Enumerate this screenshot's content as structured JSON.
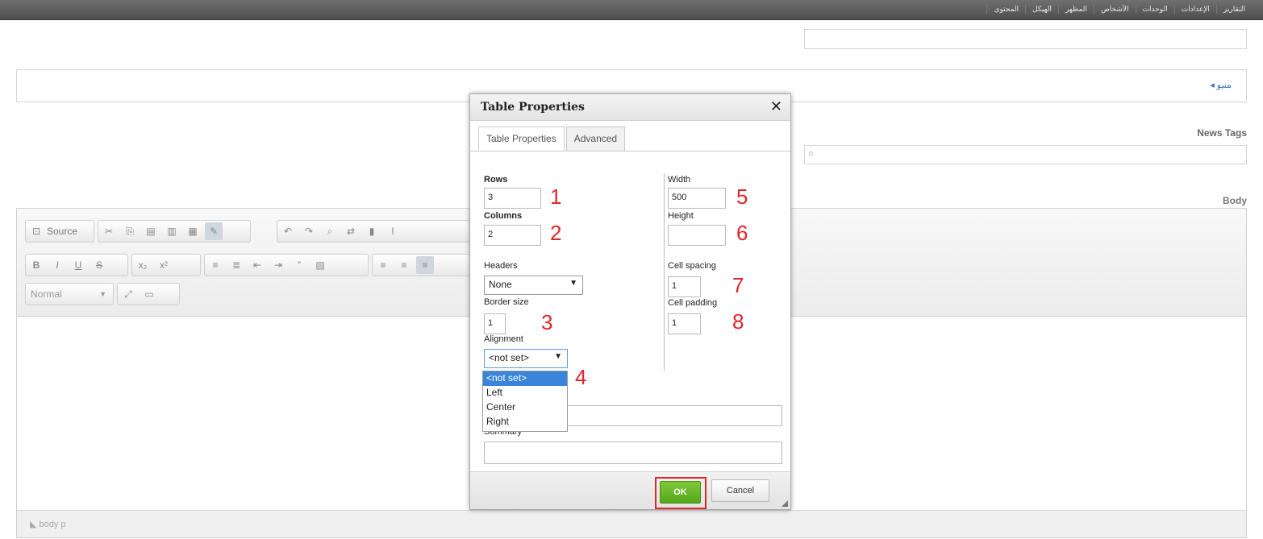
{
  "topbar": {
    "menu": [
      "المحتوى",
      "الهيكل",
      "المظهر",
      "الأشخاص",
      "الوحدات",
      "الإعدادات",
      "التقارير"
    ]
  },
  "page": {
    "menu_toggle": "منيو",
    "news_tags_label": "News Tags",
    "news_tags_value": "○",
    "body_label": "Body"
  },
  "editor": {
    "source_label": "Source",
    "format_value": "Normal",
    "status_path": "body  p"
  },
  "dialog": {
    "title": "Table Properties",
    "close": "✕",
    "tabs": [
      "Table Properties",
      "Advanced"
    ],
    "rows_label": "Rows",
    "rows_value": "3",
    "columns_label": "Columns",
    "columns_value": "2",
    "headers_label": "Headers",
    "headers_value": "None",
    "border_label": "Border size",
    "border_value": "1",
    "alignment_label": "Alignment",
    "alignment_value": "<not set>",
    "alignment_options": [
      "<not set>",
      "Left",
      "Center",
      "Right"
    ],
    "width_label": "Width",
    "width_value": "500",
    "height_label": "Height",
    "height_value": "",
    "cellspacing_label": "Cell spacing",
    "cellspacing_value": "1",
    "cellpadding_label": "Cell padding",
    "cellpadding_value": "1",
    "summary_label": "Summary",
    "ok_label": "OK",
    "cancel_label": "Cancel"
  },
  "annotations": [
    "1",
    "2",
    "3",
    "4",
    "5",
    "6",
    "7",
    "8"
  ],
  "colors": {
    "annotation_red": "#e0262a",
    "ok_green": "#6cb72a",
    "selected_option": "#3a84d9"
  }
}
